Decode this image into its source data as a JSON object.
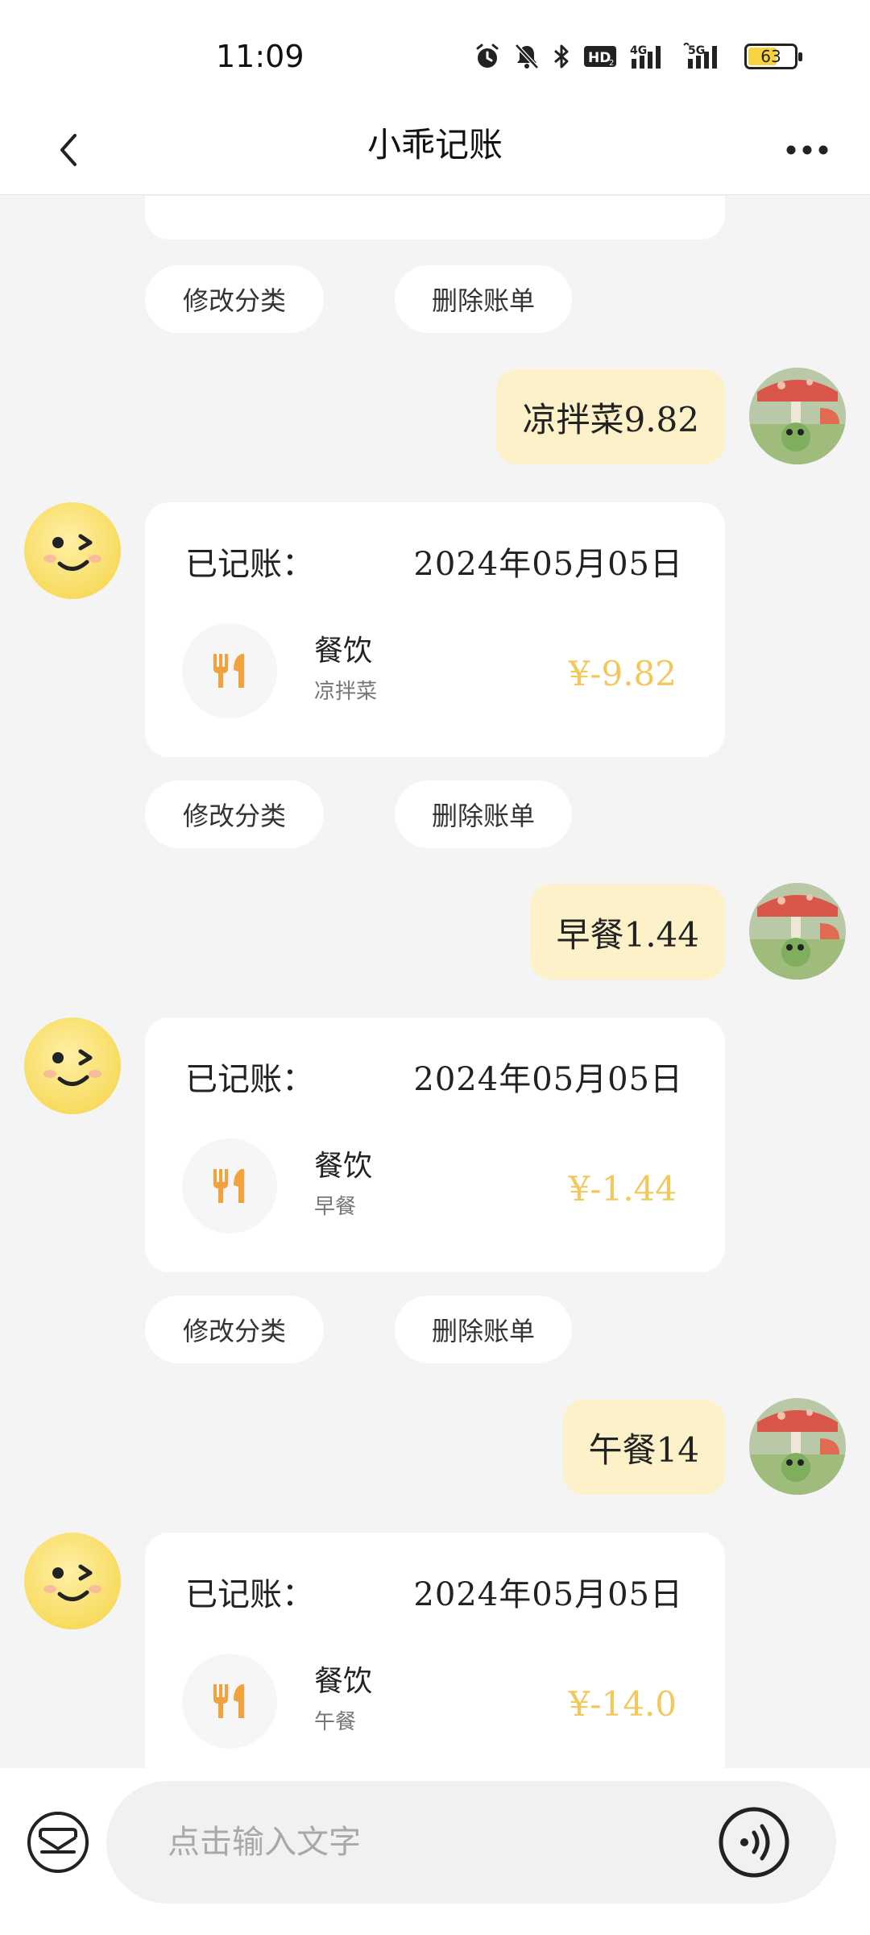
{
  "status_bar": {
    "time": "11:09",
    "icons": [
      "alarm-icon",
      "mute-icon",
      "bluetooth-icon",
      "hd-icon",
      "4g-signal-icon",
      "5g-signal-icon"
    ],
    "battery": "63",
    "battery_level": 0.63,
    "battery_color": "#f6d33f"
  },
  "nav": {
    "title": "小乖记账",
    "back_icon": "chevron-left-icon",
    "more_icon": "more-horizontal-icon"
  },
  "colors": {
    "bubble_bg": "#fdf1c9",
    "amount": "#f2c85d",
    "food_icon": "#f2a23c"
  },
  "actions": {
    "edit_label": "修改分类",
    "delete_label": "删除账单"
  },
  "messages": [
    {
      "user_text": "凉拌菜9.82",
      "card": {
        "header_label": "已记账：",
        "date": "2024年05月05日",
        "category": "餐饮",
        "note": "凉拌菜",
        "amount": "¥-9.82",
        "icon": "fork-knife-icon"
      }
    },
    {
      "user_text": "早餐1.44",
      "card": {
        "header_label": "已记账：",
        "date": "2024年05月05日",
        "category": "餐饮",
        "note": "早餐",
        "amount": "¥-1.44",
        "icon": "fork-knife-icon"
      }
    },
    {
      "user_text": "午餐14",
      "card": {
        "header_label": "已记账：",
        "date": "2024年05月05日",
        "category": "餐饮",
        "note": "午餐",
        "amount": "¥-14.0",
        "icon": "fork-knife-icon"
      }
    }
  ],
  "input": {
    "placeholder": "点击输入文字",
    "wallet_icon": "wallet-icon",
    "voice_icon": "voice-input-icon"
  }
}
